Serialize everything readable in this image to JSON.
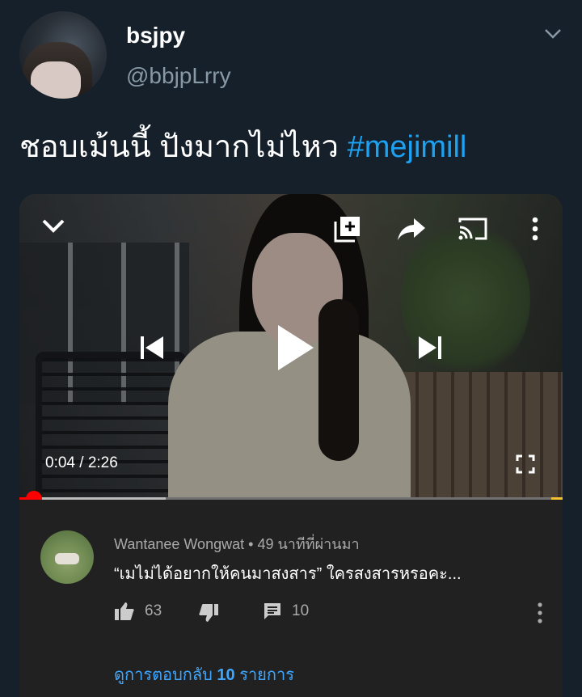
{
  "tweet": {
    "display_name": "bsjpy",
    "handle": "@bbjpLrry",
    "text": "ชอบเม้นนี้ ปังมากไม่ไหว",
    "hashtag": "#mejimill"
  },
  "video_player": {
    "time_current": "0:04",
    "time_separator": "/",
    "time_total": "2:26",
    "progress_fraction": 0.027,
    "buffered_fraction": 0.27,
    "icons": [
      "collapse-chevron-icon",
      "add-to-playlist-icon",
      "share-icon",
      "cast-icon",
      "more-vert-icon",
      "previous-icon",
      "play-icon",
      "next-icon",
      "fullscreen-icon"
    ]
  },
  "comment": {
    "author": "Wantanee Wongwat",
    "separator": "•",
    "time_ago": "49 นาทีที่ผ่านมา",
    "text": "“เมไม่ได้อยากให้คนมาสงสาร” ใครสงสารหรอคะ...",
    "likes": "63",
    "replies_count": "10",
    "view_replies_prefix": "ดูการตอบกลับ",
    "view_replies_count": "10",
    "view_replies_suffix": "รายการ"
  },
  "colors": {
    "background": "#15202b",
    "hashtag": "#1da1f2",
    "progress": "#ff0000",
    "link": "#3ea6ff",
    "card": "#212121"
  }
}
